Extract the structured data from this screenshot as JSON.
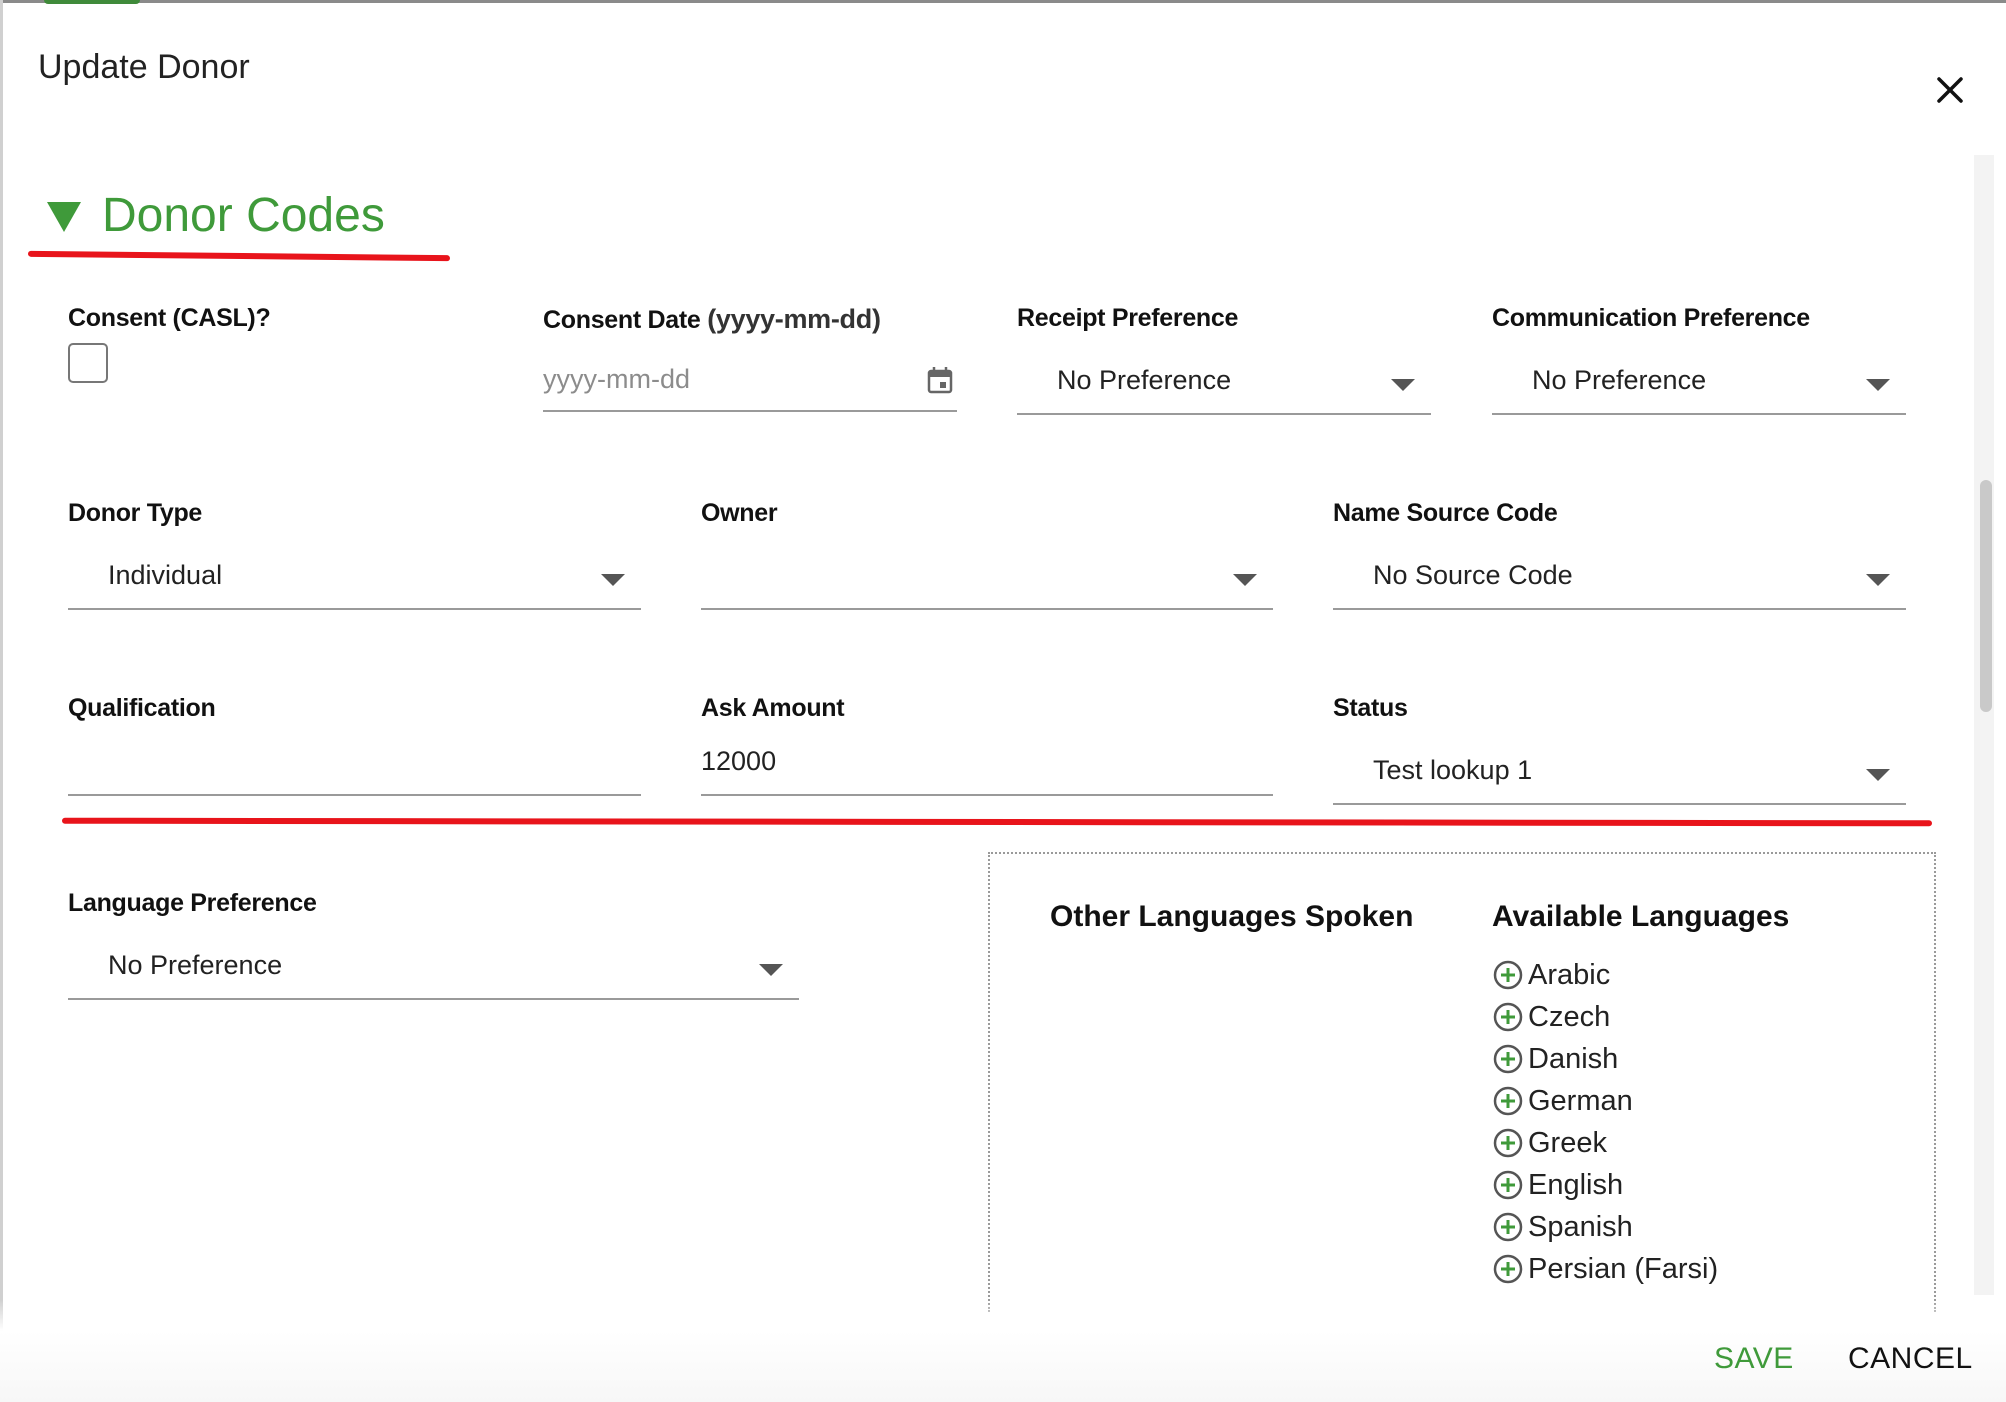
{
  "dialog": {
    "title": "Update Donor",
    "close_icon": "close-icon"
  },
  "section": {
    "title": "Donor Codes",
    "toggle_icon": "triangle-down-icon",
    "accent_color": "#3f9a3a",
    "annotation_color": "#e8141b"
  },
  "fields": {
    "consent": {
      "label": "Consent (CASL)?",
      "checked": false
    },
    "consent_date": {
      "label": "Consent Date",
      "label_suffix": "(yyyy-mm-dd)",
      "placeholder": "yyyy-mm-dd",
      "icon": "calendar-icon"
    },
    "receipt_preference": {
      "label": "Receipt Preference",
      "value": "No Preference"
    },
    "communication_preference": {
      "label": "Communication Preference",
      "value": "No Preference"
    },
    "donor_type": {
      "label": "Donor Type",
      "value": "Individual"
    },
    "owner": {
      "label": "Owner",
      "value": ""
    },
    "name_source_code": {
      "label": "Name Source Code",
      "value": "No Source Code"
    },
    "qualification": {
      "label": "Qualification",
      "value": ""
    },
    "ask_amount": {
      "label": "Ask Amount",
      "value": "12000"
    },
    "status": {
      "label": "Status",
      "value": "Test lookup 1"
    },
    "language_preference": {
      "label": "Language Preference",
      "value": "No Preference"
    }
  },
  "languages": {
    "spoken_title": "Other Languages Spoken",
    "available_title": "Available Languages",
    "add_icon": "plus-circle-icon",
    "available": [
      "Arabic",
      "Czech",
      "Danish",
      "German",
      "Greek",
      "English",
      "Spanish",
      "Persian (Farsi)"
    ]
  },
  "footer": {
    "save_label": "SAVE",
    "cancel_label": "CANCEL"
  }
}
